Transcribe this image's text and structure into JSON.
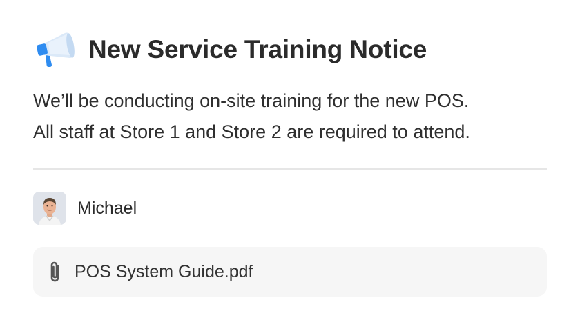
{
  "notice": {
    "title": "New Service Training Notice",
    "icon": "megaphone-icon",
    "body_lines": [
      "We’ll be conducting on-site training for the new POS.",
      "All staff at Store 1 and Store 2 are required to attend."
    ]
  },
  "author": {
    "name": "Michael",
    "avatar": "avatar"
  },
  "attachment": {
    "icon": "paperclip-icon",
    "file_name": "POS System Guide.pdf"
  },
  "colors": {
    "accent_blue": "#2f8cf0",
    "megaphone_body": "#d8e8f8",
    "divider": "#e6e6e6",
    "attachment_bg": "#f6f6f6"
  }
}
